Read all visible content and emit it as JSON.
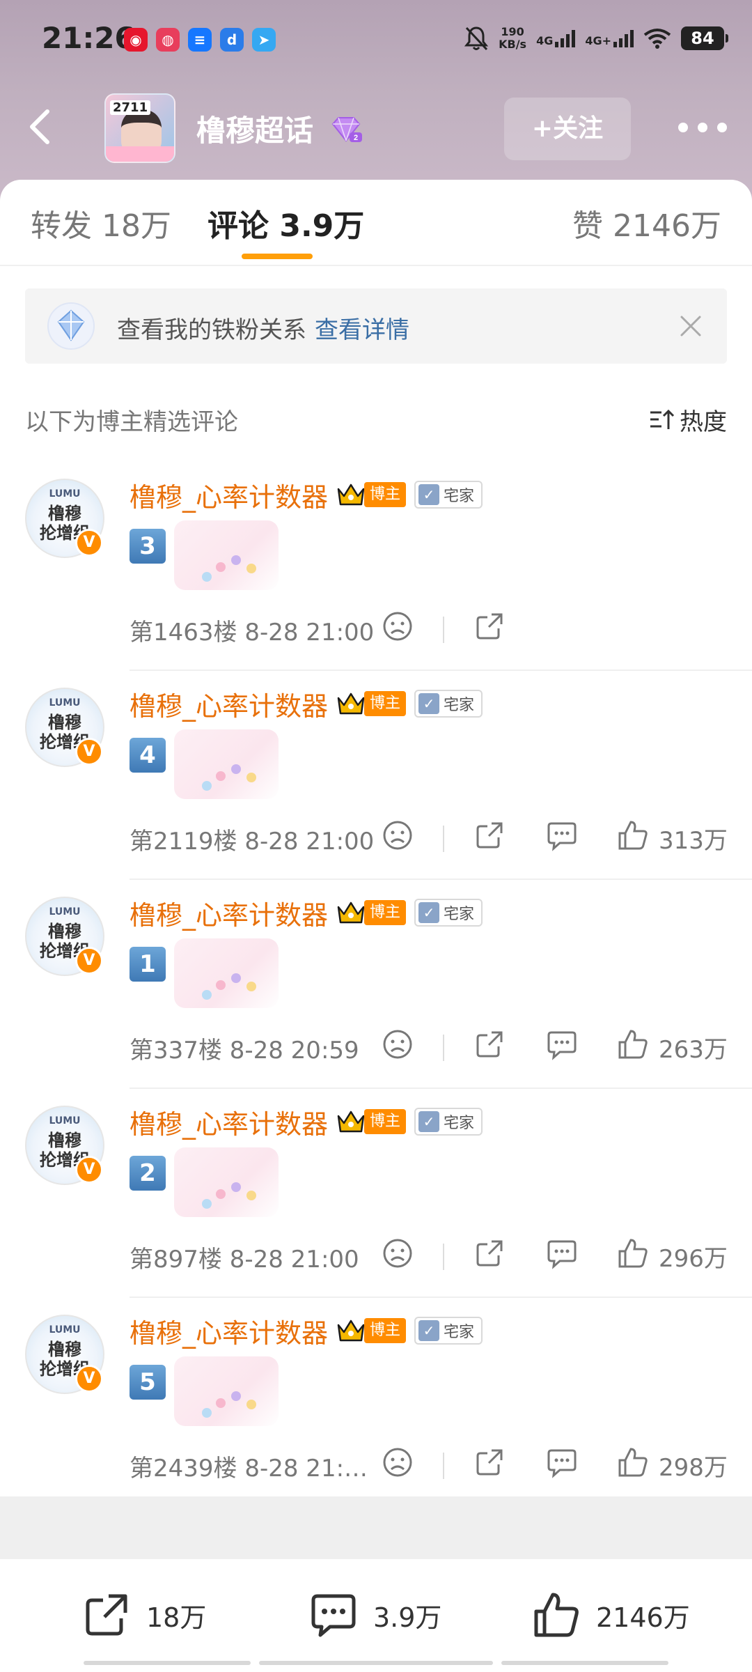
{
  "status_bar": {
    "time": "21:26",
    "net_speed": "190",
    "net_unit": "KB/s",
    "sim1": "4G",
    "sim2": "4G+",
    "battery": "84"
  },
  "header": {
    "topic_title": "橹穆超话",
    "follow_label": "+关注",
    "thumb_text": "2711"
  },
  "tabs": {
    "repost": {
      "label": "转发",
      "count": "18万"
    },
    "comment": {
      "label": "评论",
      "count": "3.9万"
    },
    "like": {
      "label": "赞",
      "count": "2146万"
    }
  },
  "fan_banner": {
    "text": "查看我的铁粉关系",
    "link": "查看详情"
  },
  "sort": {
    "label": "以下为博主精选评论",
    "button": "热度"
  },
  "comments": [
    {
      "name": "橹穆_心率计数器",
      "host_badge": "博主",
      "home_badge": "宅家",
      "avatar_top": "LUMU",
      "avatar_mid": "橹穆",
      "avatar_bot": "抡增组",
      "num": "3",
      "meta": "第1463楼 8-28 21:00",
      "likes": ""
    },
    {
      "name": "橹穆_心率计数器",
      "host_badge": "博主",
      "home_badge": "宅家",
      "avatar_top": "LUMU",
      "avatar_mid": "橹穆",
      "avatar_bot": "抡增组",
      "num": "4",
      "meta": "第2119楼 8-28 21:00",
      "likes": "313万"
    },
    {
      "name": "橹穆_心率计数器",
      "host_badge": "博主",
      "home_badge": "宅家",
      "avatar_top": "LUMU",
      "avatar_mid": "橹穆",
      "avatar_bot": "抡增组",
      "num": "1",
      "meta": "第337楼 8-28 20:59",
      "likes": "263万"
    },
    {
      "name": "橹穆_心率计数器",
      "host_badge": "博主",
      "home_badge": "宅家",
      "avatar_top": "LUMU",
      "avatar_mid": "橹穆",
      "avatar_bot": "抡增组",
      "num": "2",
      "meta": "第897楼 8-28 21:00",
      "likes": "296万"
    },
    {
      "name": "橹穆_心率计数器",
      "host_badge": "博主",
      "home_badge": "宅家",
      "avatar_top": "LUMU",
      "avatar_mid": "橹穆",
      "avatar_bot": "抡增组",
      "num": "5",
      "meta": "第2439楼 8-28 21:…",
      "likes": "298万"
    }
  ],
  "bottom_bar": {
    "repost": "18万",
    "comment": "3.9万",
    "like": "2146万"
  },
  "colors": {
    "accent": "#ff9f0a",
    "username": "#e8700a",
    "link": "#3a6ea5"
  }
}
